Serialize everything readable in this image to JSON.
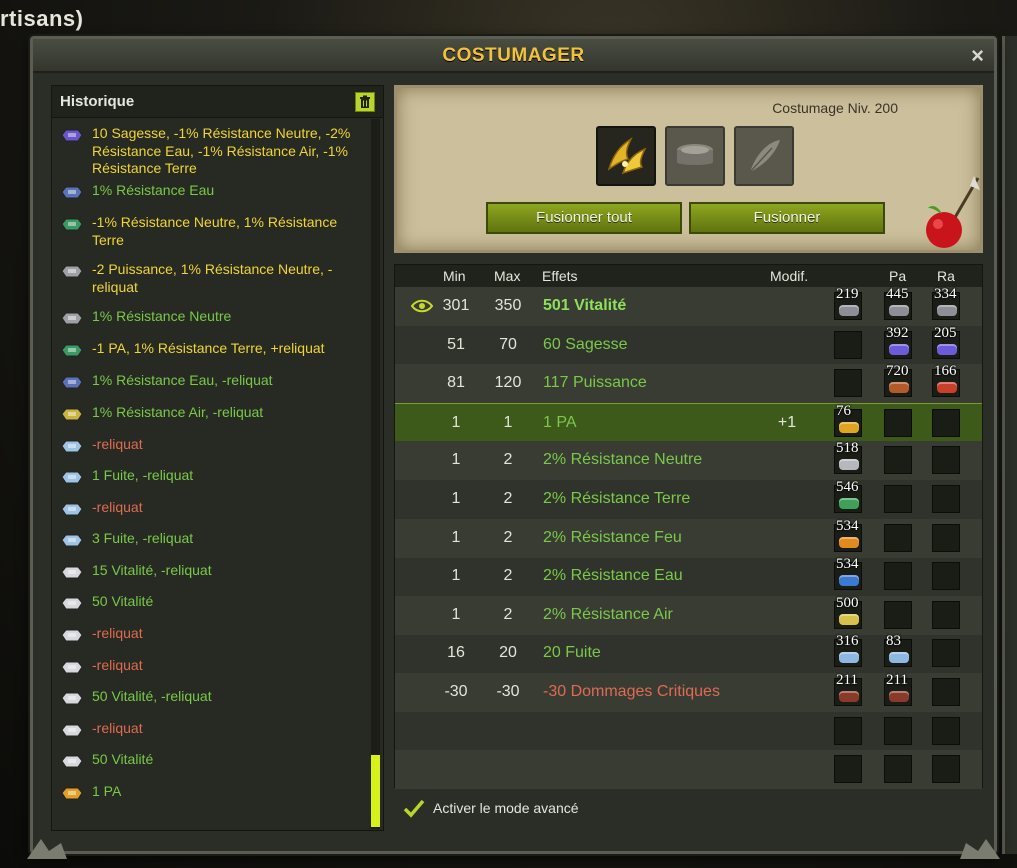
{
  "background": {
    "partial_title": "rtisans)"
  },
  "window": {
    "title": "COSTUMAGER",
    "close_label": "×"
  },
  "history": {
    "title": "Historique",
    "items": [
      {
        "text": "10 Sagesse, -1% Résistance Neutre, -2% Résistance Eau, -1% Résistance Air, -1% Résistance Terre",
        "color": "yellow",
        "icon": "purple-rune-icon"
      },
      {
        "text": "1% Résistance Eau",
        "color": "green",
        "icon": "blue-rune-icon"
      },
      {
        "text": "-1% Résistance Neutre, 1% Résistance Terre",
        "color": "yellow",
        "icon": "green-rune-icon"
      },
      {
        "text": "-2 Puissance, 1% Résistance Neutre, -reliquat",
        "color": "yellow",
        "icon": "grey-rune-icon"
      },
      {
        "text": "1% Résistance Neutre",
        "color": "green",
        "icon": "grey-rune-icon"
      },
      {
        "text": "-1 PA, 1% Résistance Terre, +reliquat",
        "color": "yellow",
        "icon": "green-rune-icon"
      },
      {
        "text": "1% Résistance Eau, -reliquat",
        "color": "green",
        "icon": "blue-rune-icon"
      },
      {
        "text": "1% Résistance Air, -reliquat",
        "color": "green",
        "icon": "yellow-rune-icon"
      },
      {
        "text": "-reliquat",
        "color": "red",
        "icon": "light-blue-rune-icon"
      },
      {
        "text": "1 Fuite, -reliquat",
        "color": "green",
        "icon": "light-blue-rune-icon"
      },
      {
        "text": "-reliquat",
        "color": "red",
        "icon": "light-blue-rune-icon"
      },
      {
        "text": "3 Fuite, -reliquat",
        "color": "green",
        "icon": "light-blue-rune-icon"
      },
      {
        "text": "15 Vitalité, -reliquat",
        "color": "green",
        "icon": "white-rune-icon"
      },
      {
        "text": "50 Vitalité",
        "color": "green",
        "icon": "white-rune-icon"
      },
      {
        "text": "-reliquat",
        "color": "red",
        "icon": "white-rune-icon"
      },
      {
        "text": "-reliquat",
        "color": "red",
        "icon": "white-rune-icon"
      },
      {
        "text": "50 Vitalité, -reliquat",
        "color": "green",
        "icon": "white-rune-icon"
      },
      {
        "text": "-reliquat",
        "color": "red",
        "icon": "white-rune-icon"
      },
      {
        "text": "50 Vitalité",
        "color": "green",
        "icon": "white-rune-icon"
      },
      {
        "text": "1 PA",
        "color": "green",
        "icon": "orange-rune-icon"
      }
    ]
  },
  "forge": {
    "level_label": "Costumage Niv. 200",
    "slots": [
      {
        "name": "item-slot",
        "icon": "golden-wings-icon",
        "active": true
      },
      {
        "name": "rune-slot",
        "icon": "rune-placeholder-icon",
        "active": false
      },
      {
        "name": "potion-slot",
        "icon": "feather-placeholder-icon",
        "active": false
      }
    ],
    "merge_all_label": "Fusionner tout",
    "merge_label": "Fusionner"
  },
  "table": {
    "headers": {
      "min": "Min",
      "max": "Max",
      "effects": "Effets",
      "modif": "Modif.",
      "pa": "Pa",
      "ra": "Ra"
    },
    "rows": [
      {
        "min": "301",
        "max": "350",
        "effect": "501 Vitalité",
        "color": "bright-green",
        "modif": "",
        "eye": true,
        "runes": [
          "219",
          "445",
          "334"
        ],
        "gems": [
          "#8c8f96",
          "#8c8f96",
          "#8c8f96"
        ]
      },
      {
        "min": "51",
        "max": "70",
        "effect": "60 Sagesse",
        "color": "green",
        "modif": "",
        "runes": [
          "",
          "392",
          "205"
        ],
        "gems": [
          "",
          "#6b5bd8",
          "#6b5bd8"
        ]
      },
      {
        "min": "81",
        "max": "120",
        "effect": "117 Puissance",
        "color": "green",
        "modif": "",
        "runes": [
          "",
          "720",
          "166"
        ],
        "gems": [
          "",
          "#b25a2a",
          "#c8402a"
        ]
      },
      {
        "min": "1",
        "max": "1",
        "effect": "1 PA",
        "color": "green",
        "modif": "+1",
        "highlight": true,
        "runes": [
          "76",
          "",
          ""
        ],
        "gems": [
          "#e0a520",
          "",
          ""
        ]
      },
      {
        "min": "1",
        "max": "2",
        "effect": "2% Résistance Neutre",
        "color": "green",
        "modif": "",
        "runes": [
          "518",
          "",
          ""
        ],
        "gems": [
          "#b5b8bd",
          "",
          ""
        ]
      },
      {
        "min": "1",
        "max": "2",
        "effect": "2% Résistance Terre",
        "color": "green",
        "modif": "",
        "runes": [
          "546",
          "",
          ""
        ],
        "gems": [
          "#3ea05a",
          "",
          ""
        ]
      },
      {
        "min": "1",
        "max": "2",
        "effect": "2% Résistance Feu",
        "color": "green",
        "modif": "",
        "runes": [
          "534",
          "",
          ""
        ],
        "gems": [
          "#e08a20",
          "",
          ""
        ]
      },
      {
        "min": "1",
        "max": "2",
        "effect": "2% Résistance Eau",
        "color": "green",
        "modif": "",
        "runes": [
          "534",
          "",
          ""
        ],
        "gems": [
          "#3a7ad0",
          "",
          ""
        ]
      },
      {
        "min": "1",
        "max": "2",
        "effect": "2% Résistance Air",
        "color": "green",
        "modif": "",
        "runes": [
          "500",
          "",
          ""
        ],
        "gems": [
          "#d6c24a",
          "",
          ""
        ]
      },
      {
        "min": "16",
        "max": "20",
        "effect": "20 Fuite",
        "color": "green",
        "modif": "",
        "runes": [
          "316",
          "83",
          ""
        ],
        "gems": [
          "#8fb8e0",
          "#8fb8e0",
          ""
        ]
      },
      {
        "min": "-30",
        "max": "-30",
        "effect": "-30 Dommages Critiques",
        "color": "red",
        "modif": "",
        "runes": [
          "211",
          "211",
          ""
        ],
        "gems": [
          "#8a3a2a",
          "#8a3a2a",
          ""
        ]
      },
      {
        "min": "",
        "max": "",
        "effect": "",
        "color": "green",
        "modif": "",
        "runes": [
          "",
          "",
          ""
        ],
        "gems": [
          "",
          "",
          ""
        ]
      },
      {
        "min": "",
        "max": "",
        "effect": "",
        "color": "green",
        "modif": "",
        "runes": [
          "",
          "",
          ""
        ],
        "gems": [
          "",
          "",
          ""
        ]
      }
    ]
  },
  "advanced_mode": {
    "label": "Activer le mode avancé",
    "checked": true
  },
  "colors": {
    "accent_yellow": "#f2c33a",
    "effect_green": "#7bc84a",
    "effect_red": "#e06a52",
    "history_yellow": "#f1d534",
    "button_green": "#7d9a1f"
  }
}
